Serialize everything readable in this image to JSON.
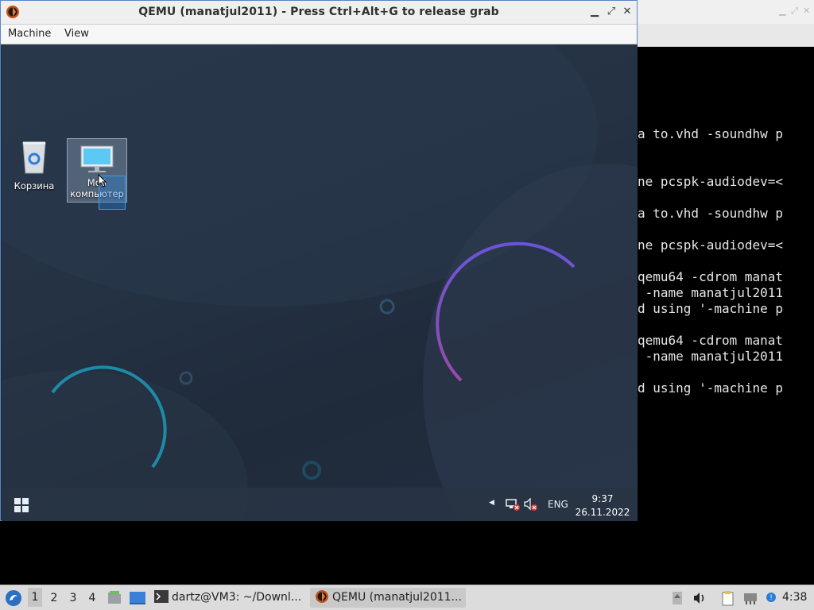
{
  "qemu": {
    "title": "QEMU (manatjul2011) - Press Ctrl+Alt+G to release grab",
    "menu": [
      "Machine",
      "View"
    ],
    "controls": {
      "minimize": "▁",
      "maximize": "⤢",
      "close": "✕"
    }
  },
  "terminal": {
    "lines": [
      "a to.vhd -soundhw p",
      "ne pcspk-audiodev=<",
      "a to.vhd -soundhw p",
      "ne pcspk-audiodev=<",
      "qemu64 -cdrom manat",
      " -name manatjul2011",
      "d using '-machine p",
      "qemu64 -cdrom manat",
      " -name manatjul2011",
      "d using '-machine p"
    ]
  },
  "guest": {
    "desktop_icons": [
      {
        "label": "Корзина",
        "icon": "recycle-bin-icon"
      },
      {
        "label": "Мой компьютер",
        "icon": "computer-icon"
      }
    ],
    "taskbar": {
      "language": "ENG",
      "time": "9:37",
      "date": "26.11.2022",
      "tray_icons": [
        "chevron-left-icon",
        "network-disconnected-icon",
        "volume-muted-icon"
      ]
    }
  },
  "host_taskbar": {
    "workspaces": [
      "1",
      "2",
      "3",
      "4"
    ],
    "active_workspace": "1",
    "tasks": [
      {
        "label": "dartz@VM3: ~/Downl...",
        "icon": "terminal-icon"
      },
      {
        "label": "QEMU (manatjul2011...",
        "icon": "qemu-icon",
        "active": true
      }
    ],
    "clock": "4:38",
    "tray_icons": [
      "upload-icon",
      "volume-icon",
      "clipboard-icon",
      "network-icon",
      "notification-icon",
      "screenshot-icon"
    ]
  },
  "colors": {
    "accent": "#5b84c8",
    "guest_ring_purple": "#7a4fc8",
    "guest_ring_teal": "#1f8aa8"
  }
}
